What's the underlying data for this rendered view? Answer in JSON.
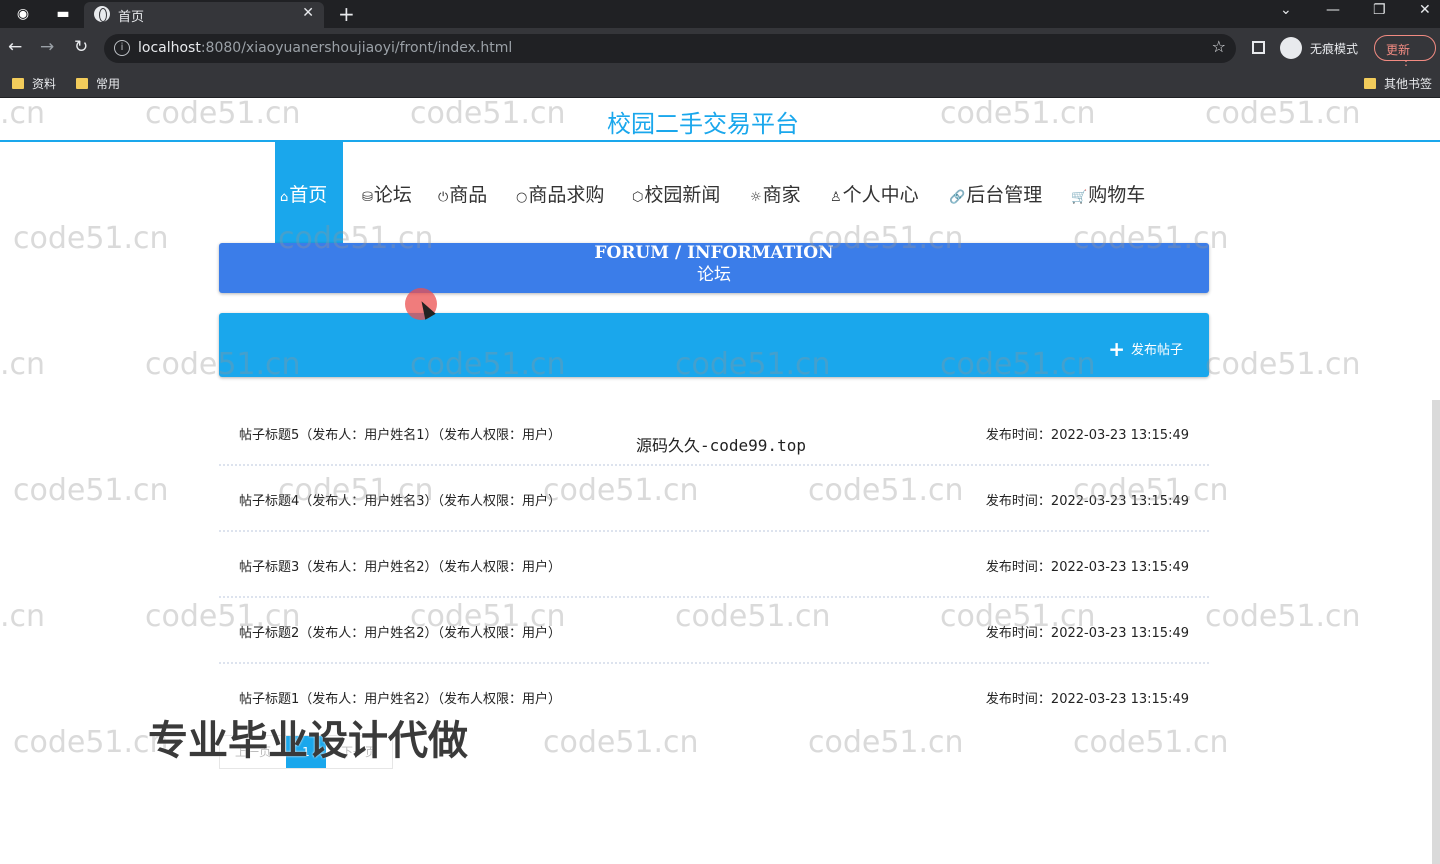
{
  "browser": {
    "tab_title": "首页",
    "url_host": "localhost",
    "url_rest": ":8080/xiaoyuanershoujiaoyi/front/index.html",
    "incognito_label": "无痕模式",
    "update_label": "更新",
    "bookmarks": [
      "资料",
      "常用"
    ],
    "other_bookmarks": "其他书签"
  },
  "site": {
    "title": "校园二手交易平台"
  },
  "nav": [
    {
      "icon": "⌂",
      "label": "首页"
    },
    {
      "icon": "⛁",
      "label": "论坛"
    },
    {
      "icon": "⏻",
      "label": "商品"
    },
    {
      "icon": "○",
      "label": "商品求购"
    },
    {
      "icon": "⬡",
      "label": "校园新闻"
    },
    {
      "icon": "☼",
      "label": "商家"
    },
    {
      "icon": "♙",
      "label": "个人中心"
    },
    {
      "icon": "🔗",
      "label": "后台管理"
    },
    {
      "icon": "🛒",
      "label": "购物车"
    }
  ],
  "banner": {
    "en": "FORUM / INFORMATION",
    "cn": "论坛"
  },
  "action": {
    "post_label": "发布帖子"
  },
  "posts": [
    {
      "title": "帖子标题5（发布人：用户姓名1）（发布人权限：用户）",
      "time": "发布时间：2022-03-23 13:15:49"
    },
    {
      "title": "帖子标题4（发布人：用户姓名3）（发布人权限：用户）",
      "time": "发布时间：2022-03-23 13:15:49"
    },
    {
      "title": "帖子标题3（发布人：用户姓名2）（发布人权限：用户）",
      "time": "发布时间：2022-03-23 13:15:49"
    },
    {
      "title": "帖子标题2（发布人：用户姓名2）（发布人权限：用户）",
      "time": "发布时间：2022-03-23 13:15:49"
    },
    {
      "title": "帖子标题1（发布人：用户姓名2）（发布人权限：用户）",
      "time": "发布时间：2022-03-23 13:15:49"
    }
  ],
  "pager": {
    "prev": "上一页",
    "current": "1",
    "next": "下一页"
  },
  "overlays": {
    "watermark": "code51.cn",
    "source_text": "源码久久-code99.top",
    "ad_text": "专业毕业设计代做"
  }
}
